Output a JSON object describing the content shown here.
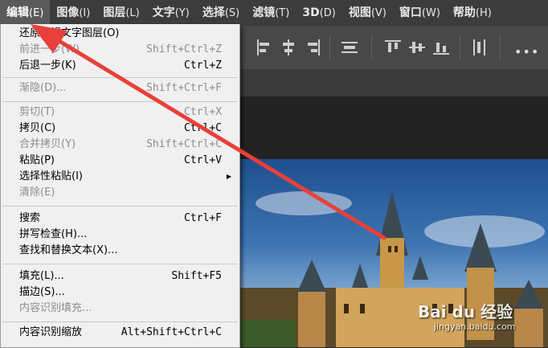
{
  "menubar": {
    "items": [
      {
        "label": "编辑",
        "acc": "(E)"
      },
      {
        "label": "图像",
        "acc": "(I)"
      },
      {
        "label": "图层",
        "acc": "(L)"
      },
      {
        "label": "文字",
        "acc": "(Y)"
      },
      {
        "label": "选择",
        "acc": "(S)"
      },
      {
        "label": "滤镜",
        "acc": "(T)"
      },
      {
        "label": "3D",
        "acc": "(D)"
      },
      {
        "label": "视图",
        "acc": "(V)"
      },
      {
        "label": "窗口",
        "acc": "(W)"
      },
      {
        "label": "帮助",
        "acc": "(H)"
      }
    ]
  },
  "optionsbar": {
    "more": "•••"
  },
  "menu": {
    "items": [
      {
        "label": "还原编辑文字图层(O)",
        "shortcut": "",
        "enabled": true
      },
      {
        "label": "前进一步(W)",
        "shortcut": "Shift+Ctrl+Z",
        "enabled": false
      },
      {
        "label": "后退一步(K)",
        "shortcut": "Ctrl+Z",
        "enabled": true
      },
      {
        "label": "渐隐(D)...",
        "shortcut": "Shift+Ctrl+F",
        "enabled": false
      },
      {
        "label": "剪切(T)",
        "shortcut": "Ctrl+X",
        "enabled": false
      },
      {
        "label": "拷贝(C)",
        "shortcut": "Ctrl+C",
        "enabled": true
      },
      {
        "label": "合并拷贝(Y)",
        "shortcut": "Shift+Ctrl+C",
        "enabled": false
      },
      {
        "label": "粘贴(P)",
        "shortcut": "Ctrl+V",
        "enabled": true
      },
      {
        "label": "选择性粘贴(I)",
        "shortcut": "",
        "enabled": true,
        "submenu": true
      },
      {
        "label": "清除(E)",
        "shortcut": "",
        "enabled": false
      },
      {
        "label": "搜索",
        "shortcut": "Ctrl+F",
        "enabled": true
      },
      {
        "label": "拼写检查(H)...",
        "shortcut": "",
        "enabled": true
      },
      {
        "label": "查找和替换文本(X)...",
        "shortcut": "",
        "enabled": true
      },
      {
        "label": "填充(L)...",
        "shortcut": "Shift+F5",
        "enabled": true
      },
      {
        "label": "描边(S)...",
        "shortcut": "",
        "enabled": true
      },
      {
        "label": "内容识别填充...",
        "shortcut": "",
        "enabled": false
      },
      {
        "label": "内容识别缩放",
        "shortcut": "Alt+Shift+Ctrl+C",
        "enabled": true
      }
    ]
  },
  "watermark": {
    "brand": "Bai du 经验",
    "url": "jingyan.baidu.com"
  },
  "colors": {
    "arrow": "#e8403a",
    "menu_bg": "#f0f0f0",
    "menubar_bg": "#3c3c3c"
  }
}
